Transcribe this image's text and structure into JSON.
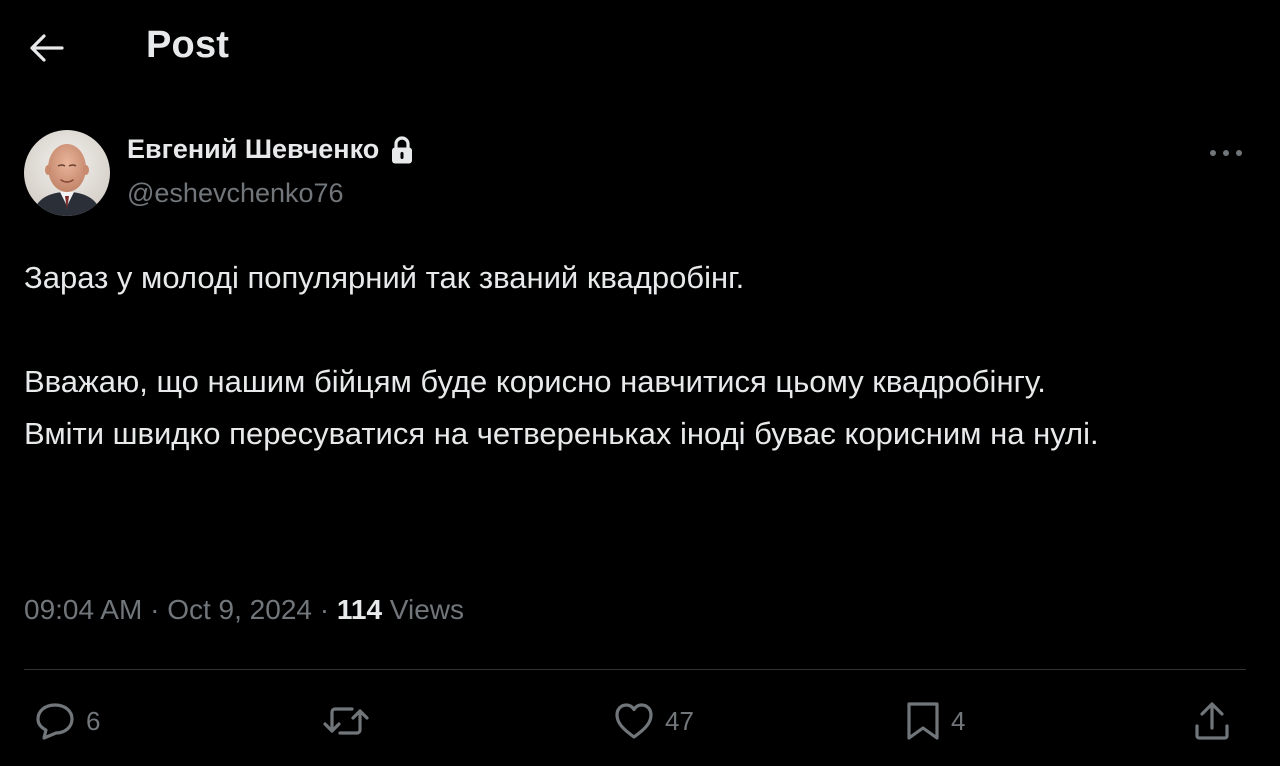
{
  "header": {
    "title": "Post",
    "back_icon": "arrow-left-icon"
  },
  "author": {
    "name": "Евгений Шевченко",
    "handle": "@eshevchenko76",
    "protected_icon": "lock-icon"
  },
  "post": {
    "paragraph_1": "Зараз у молоді популярний так званий квадробінг.",
    "paragraph_2": "Вважаю, що нашим бійцям буде корисно навчитися цьому квадробінгу.",
    "paragraph_3": "Вміти швидко пересуватися на четвереньках іноді буває корисним на нулі."
  },
  "meta": {
    "time": "09:04 AM",
    "separator": " · ",
    "date": "Oct 9, 2024",
    "views_count": "114",
    "views_label": " Views"
  },
  "actions": {
    "reply_count": "6",
    "repost_count": "",
    "like_count": "47",
    "bookmark_count": "4"
  },
  "colors": {
    "background": "#000000",
    "text_primary": "#e7e9ea",
    "text_secondary": "#71767b",
    "divider": "#2f3336"
  }
}
